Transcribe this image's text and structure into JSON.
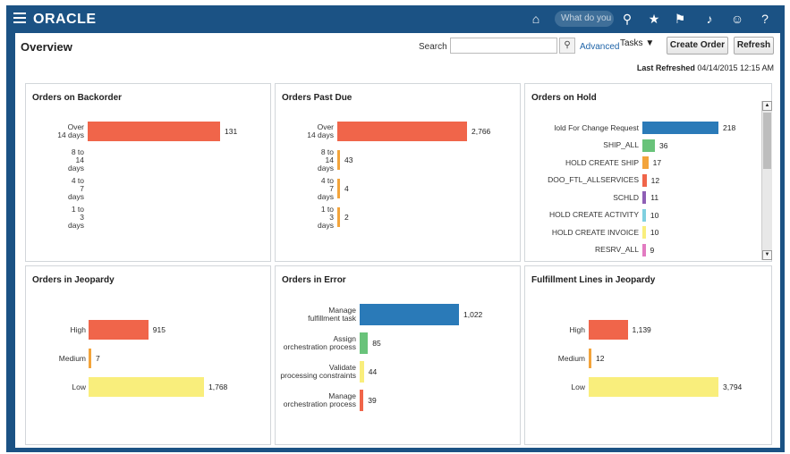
{
  "header": {
    "logo": "ORACLE",
    "search_placeholder": "What do you n"
  },
  "page": {
    "title": "Overview",
    "search_label": "Search",
    "advanced_label": "Advanced",
    "tasks_label": "Tasks ▼",
    "create_order_label": "Create Order",
    "refresh_label": "Refresh",
    "last_refreshed_label": "Last Refreshed",
    "last_refreshed_value": "04/14/2015 12:15 AM"
  },
  "colors": {
    "red": "#f0654a",
    "orange": "#f3a43b",
    "yellow": "#f9ee7c",
    "blue": "#2a7ab8",
    "green": "#69c37a",
    "purple": "#8e5fb5",
    "cyan": "#7fd0e0",
    "pink": "#e27bc1"
  },
  "chart_data": [
    {
      "type": "bar",
      "title": "Orders on Backorder",
      "categories": [
        "Over 14 days",
        "8 to 14 days",
        "4 to 7 days",
        "1 to 3 days"
      ],
      "values": [
        131,
        0,
        0,
        0
      ],
      "value_labels": [
        "131",
        "",
        "",
        ""
      ]
    },
    {
      "type": "bar",
      "title": "Orders Past Due",
      "categories": [
        "Over 14 days",
        "8 to 14 days",
        "4 to 7 days",
        "1 to 3 days"
      ],
      "values": [
        2766,
        43,
        4,
        2
      ],
      "value_labels": [
        "2,766",
        "43",
        "4",
        "2"
      ]
    },
    {
      "type": "bar",
      "title": "Orders on Hold",
      "categories": [
        "lold For Change Request",
        "SHIP_ALL",
        "HOLD CREATE SHIP",
        "DOO_FTL_ALLSERVICES",
        "SCHLD",
        "HOLD CREATE ACTIVITY",
        "HOLD CREATE INVOICE",
        "RESRV_ALL"
      ],
      "values": [
        218,
        36,
        17,
        12,
        11,
        10,
        10,
        9
      ],
      "value_labels": [
        "218",
        "36",
        "17",
        "12",
        "11",
        "10",
        "10",
        "9"
      ]
    },
    {
      "type": "bar",
      "title": "Orders in Jeopardy",
      "categories": [
        "High",
        "Medium",
        "Low"
      ],
      "values": [
        915,
        7,
        1768
      ],
      "value_labels": [
        "915",
        "7",
        "1,768"
      ]
    },
    {
      "type": "bar",
      "title": "Orders in Error",
      "categories": [
        "Manage fulfillment task",
        "Assign orchestration process",
        "Validate processing constraints",
        "Manage orchestration process"
      ],
      "values": [
        1022,
        85,
        44,
        39
      ],
      "value_labels": [
        "1,022",
        "85",
        "44",
        "39"
      ]
    },
    {
      "type": "bar",
      "title": "Fulfillment Lines in Jeopardy",
      "categories": [
        "High",
        "Medium",
        "Low"
      ],
      "values": [
        1139,
        12,
        3794
      ],
      "value_labels": [
        "1,139",
        "12",
        "3,794"
      ]
    }
  ]
}
